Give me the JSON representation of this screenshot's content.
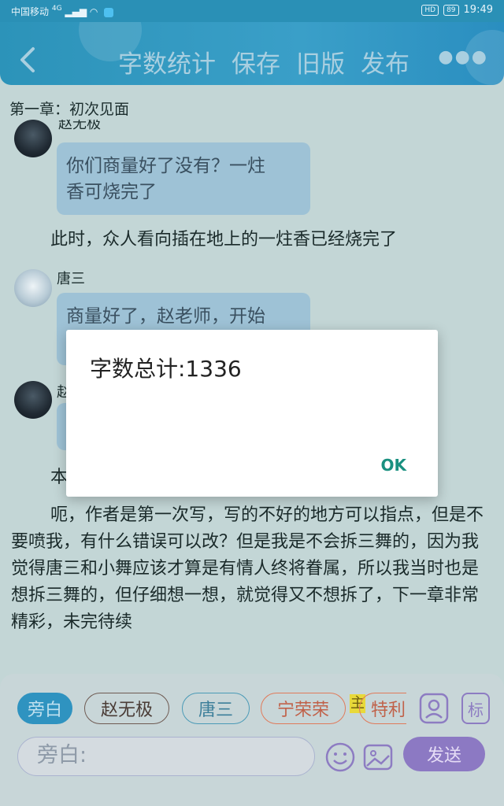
{
  "status_bar": {
    "carrier": "中国移动",
    "network": "4G",
    "hd": "HD",
    "battery": "89",
    "time": "19:49"
  },
  "header": {
    "back_icon": "chevron-left-icon",
    "actions": [
      "字数统计",
      "保存",
      "旧版",
      "发布"
    ],
    "more_icon": "more-dots-icon"
  },
  "chapter_title": "第一章：初次见面",
  "messages": [
    {
      "name": "赵无极",
      "avatar": "dark",
      "text_line1": "你们商量好了没有？一炷",
      "text_line2": "香可烧完了"
    },
    {
      "narration": "此时，众人看向插在地上的一炷香已经烧完了"
    },
    {
      "name": "唐三",
      "avatar": "light",
      "text_line1": "商量好了，赵老师，开始"
    },
    {
      "name": "赵",
      "avatar": "dark"
    },
    {
      "narration_partial": "本"
    },
    {
      "narration": "呃，作者是第一次写，写的不好的地方可以指点，但是不要喷我，有什么错误可以改？但是我是不会拆三舞的，因为我觉得唐三和小舞应该才算是有情人终将眷属，所以我当时也是想拆三舞的，但仔细想一想，就觉得又不想拆了，下一章非常精彩，未完待续"
    }
  ],
  "dialog": {
    "message": "字数总计:1336",
    "ok_label": "OK"
  },
  "composer": {
    "characters": [
      "旁白",
      "赵无极",
      "唐三",
      "宁荣荣",
      "特利"
    ],
    "tag_main": "主",
    "input_value": "旁白:",
    "send_label": "发送",
    "icons": [
      "person-icon",
      "tag-icon",
      "emoji-icon",
      "image-icon"
    ],
    "tag_label": "标"
  },
  "colors": {
    "header": "#2c93b9",
    "dialog_ok": "#1a9080",
    "send": "#8c79c3"
  }
}
